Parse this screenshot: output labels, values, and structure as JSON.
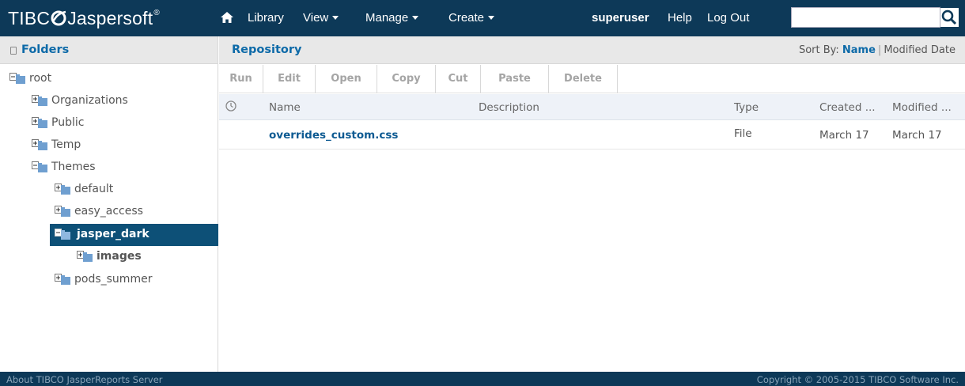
{
  "header": {
    "logo_main": "TIBC",
    "logo_tail": "Jaspersoft",
    "logo_reg": "®",
    "nav": {
      "library": "Library",
      "view": "View",
      "manage": "Manage",
      "create": "Create",
      "user": "superuser",
      "help": "Help",
      "logout": "Log Out"
    },
    "search": {
      "value": "",
      "placeholder": ""
    },
    "icons": {
      "home": "home-icon",
      "search": "magnifier-icon"
    }
  },
  "folders": {
    "title": "Folders",
    "tree": {
      "root": "root",
      "organizations": "Organizations",
      "public": "Public",
      "temp": "Temp",
      "themes": "Themes",
      "default": "default",
      "easy_access": "easy_access",
      "jasper_dark": "jasper_dark",
      "images": "images",
      "pods_summer": "pods_summer"
    },
    "selected": "jasper_dark"
  },
  "repository": {
    "title": "Repository",
    "sort": {
      "label": "Sort By:",
      "name": "Name",
      "modified": "Modified Date",
      "active": "Name"
    },
    "toolbar": {
      "run": "Run",
      "edit": "Edit",
      "open": "Open",
      "copy": "Copy",
      "cut": "Cut",
      "paste": "Paste",
      "delete": "Delete"
    },
    "columns": {
      "name": "Name",
      "description": "Description",
      "type": "Type",
      "created": "Created ...",
      "modified": "Modified ..."
    },
    "rows": [
      {
        "name": "overrides_custom.css",
        "description": "",
        "type": "File",
        "created": "March 17",
        "modified": "March 17"
      }
    ]
  },
  "footer": {
    "about": "About TIBCO JasperReports Server",
    "copyright": "Copyright © 2005-2015 TIBCO Software Inc."
  },
  "colors": {
    "brand_navy": "#0d3958",
    "selection": "#0d5077",
    "link_blue": "#0d6aa8",
    "panel_gray": "#e8e8e8",
    "table_header": "#eef2f8"
  }
}
